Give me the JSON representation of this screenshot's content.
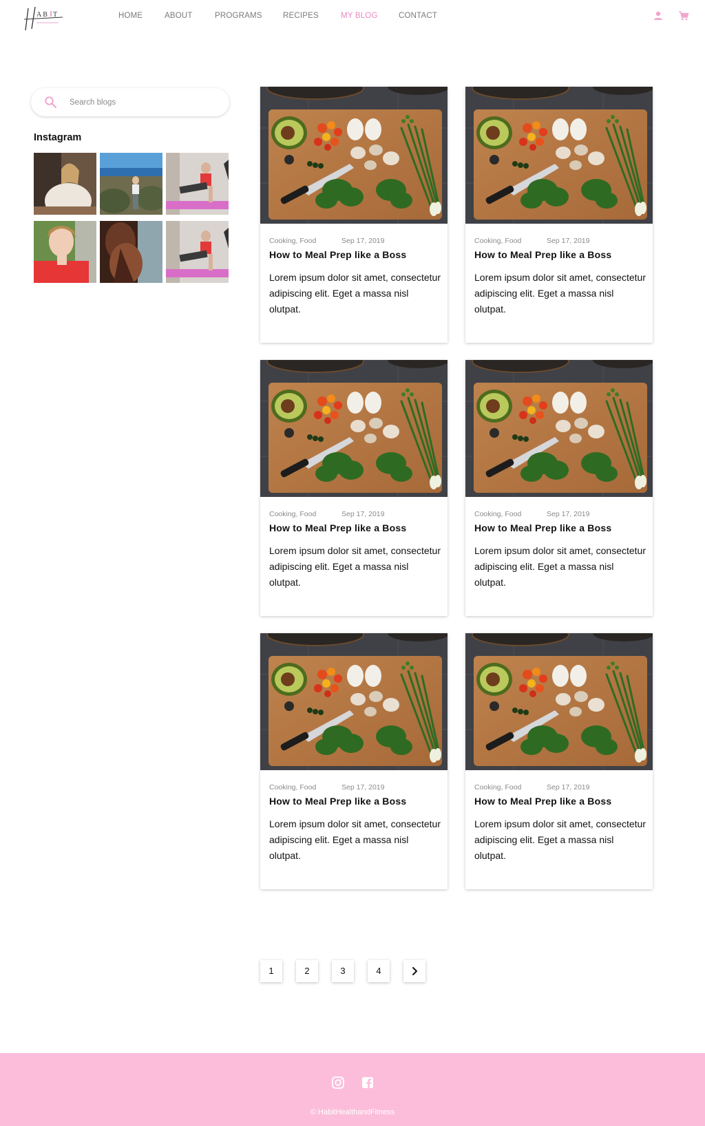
{
  "brand": {
    "logo_text": "HABIT",
    "logo_sub": "Health & Fitness"
  },
  "nav": {
    "items": [
      "HOME",
      "ABOUT",
      "PROGRAMS",
      "RECIPES",
      "MY BLOG",
      "CONTACT"
    ],
    "active": "MY BLOG"
  },
  "header_icons": [
    "user-icon",
    "cart-icon"
  ],
  "search": {
    "placeholder": "Search blogs",
    "value": ""
  },
  "instagram": {
    "title": "Instagram"
  },
  "cards": [
    {
      "categories": "Cooking, Food",
      "date": "Sep 17, 2019",
      "title": "How to Meal Prep like a Boss",
      "excerpt": "Lorem ipsum dolor sit amet, consectetur adipiscing elit. Eget a massa nisl olutpat."
    },
    {
      "categories": "Cooking, Food",
      "date": "Sep 17, 2019",
      "title": "How to Meal Prep like a Boss",
      "excerpt": "Lorem ipsum dolor sit amet, consectetur adipiscing elit. Eget a massa nisl olutpat."
    },
    {
      "categories": "Cooking, Food",
      "date": "Sep 17, 2019",
      "title": "How to Meal Prep like a Boss",
      "excerpt": "Lorem ipsum dolor sit amet, consectetur adipiscing elit. Eget a massa nisl olutpat."
    },
    {
      "categories": "Cooking, Food",
      "date": "Sep 17, 2019",
      "title": "How to Meal Prep like a Boss",
      "excerpt": "Lorem ipsum dolor sit amet, consectetur adipiscing elit. Eget a massa nisl olutpat."
    },
    {
      "categories": "Cooking, Food",
      "date": "Sep 17, 2019",
      "title": "How to Meal Prep like a Boss",
      "excerpt": "Lorem ipsum dolor sit amet, consectetur adipiscing elit. Eget a massa nisl olutpat."
    },
    {
      "categories": "Cooking, Food",
      "date": "Sep 17, 2019",
      "title": "How to Meal Prep like a Boss",
      "excerpt": "Lorem ipsum dolor sit amet, consectetur adipiscing elit. Eget a massa nisl olutpat."
    }
  ],
  "pagination": {
    "pages": [
      "1",
      "2",
      "3",
      "4"
    ],
    "next_icon": "chevron-right-icon"
  },
  "footer": {
    "social_icons": [
      "instagram-icon",
      "facebook-icon"
    ],
    "copyright": "© HabitHealthandFitness"
  },
  "colors": {
    "accent": "#e88ac2",
    "footer_bg": "#fcbddb"
  }
}
